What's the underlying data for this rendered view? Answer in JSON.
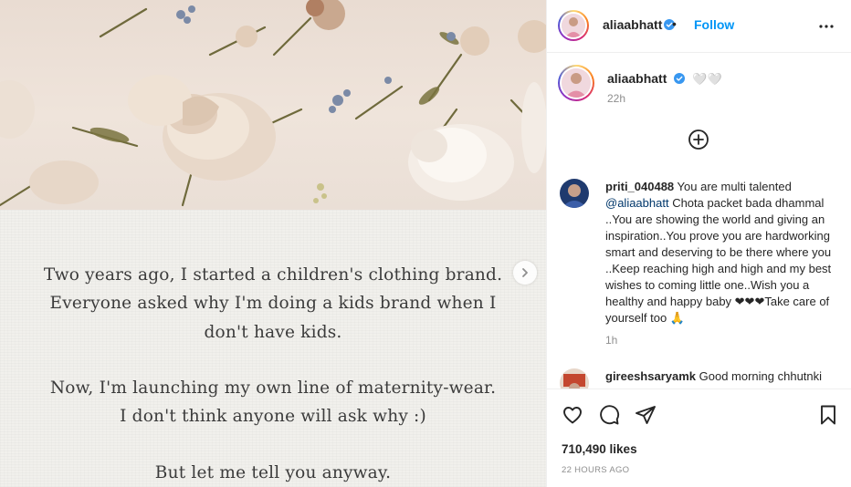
{
  "post": {
    "card_lines": [
      "Two years ago, I started a children's clothing brand.",
      "Everyone asked why I'm doing a kids brand when I",
      "don't have kids.",
      "Now, I'm launching my own line of maternity-wear.",
      "I don't think anyone will ask why :)",
      "But let me tell you anyway."
    ]
  },
  "header": {
    "username": "aliaabhatt",
    "dot": "•",
    "follow_label": "Follow"
  },
  "caption": {
    "username": "aliaabhatt",
    "text": "🤍🤍",
    "time": "22h"
  },
  "comments": [
    {
      "username": "priti_040488",
      "text_before": " You are multi talented ",
      "mention": "@aliaabhatt",
      "text_after": " Chota packet bada dhammal ..You are showing the world and giving an inspiration..You prove you are hardworking smart and deserving to be there where you ..Keep reaching high and high and my best wishes to coming little one..Wish you a healthy and happy baby ❤❤❤Take care of yourself too 🙏",
      "time": "1h"
    },
    {
      "username": "gireeshsaryamk",
      "text": " Good morning chhutnki"
    }
  ],
  "footer": {
    "likes": "710,490 likes",
    "time": "22 HOURS AGO"
  },
  "colors": {
    "link_blue": "#0095f6",
    "verified_blue": "#3897f0",
    "mention_blue": "#00376b",
    "muted": "#8e8e8e"
  },
  "icons": [
    "heart-icon",
    "comment-icon",
    "share-icon",
    "bookmark-icon",
    "more-icon",
    "add-circle-icon",
    "chevron-right-icon",
    "verified-icon"
  ]
}
